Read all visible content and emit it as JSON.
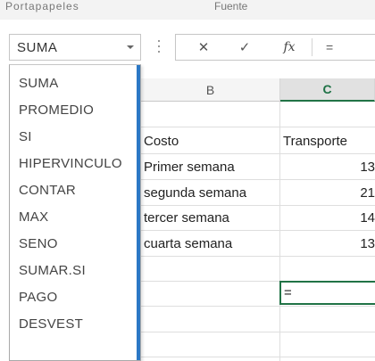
{
  "ribbon": {
    "group_left": "Portapapeles",
    "group_right": "Fuente"
  },
  "namebox": {
    "value": "SUMA"
  },
  "formula_bar": {
    "cancel": "✕",
    "enter": "✓",
    "fx": "fx",
    "input": "="
  },
  "columns": {
    "b": "B",
    "c": "C"
  },
  "rows": [
    {
      "b": "Costo",
      "c": "Transporte"
    },
    {
      "b": "Primer semana",
      "c": "13"
    },
    {
      "b": "segunda semana",
      "c": "21"
    },
    {
      "b": "tercer semana",
      "c": "14"
    },
    {
      "b": "cuarta semana",
      "c": "13"
    }
  ],
  "active_cell": {
    "value": "="
  },
  "function_list": [
    "SUMA",
    "PROMEDIO",
    "SI",
    "HIPERVINCULO",
    "CONTAR",
    "MAX",
    "SENO",
    "SUMAR.SI",
    "PAGO",
    "DESVEST"
  ],
  "icons": {
    "dropdown": "chevron-down-icon",
    "cancel": "close-icon",
    "enter": "check-icon",
    "fx": "function-icon"
  },
  "colors": {
    "selected_column": "#217346",
    "list_scrollbar": "#2b78c5"
  }
}
